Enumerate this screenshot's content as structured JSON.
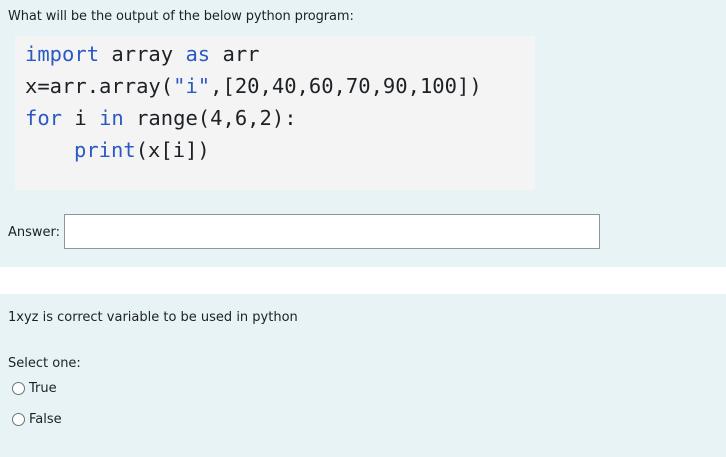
{
  "question1": {
    "prompt": "What will be the output of the below python program:",
    "code": {
      "line1": {
        "kw_import": "import",
        "mid": " array ",
        "kw_as": "as",
        "end": " arr"
      },
      "line2": {
        "start": "x=arr.array(",
        "str": "\"i\"",
        "end": ",[20,40,60,70,90,100])"
      },
      "line3": {
        "kw_for": "for",
        "mid": " i ",
        "kw_in": "in",
        "end": " range(4,6,2):"
      },
      "line4": {
        "fn": "print",
        "end": "(x[i])"
      }
    },
    "answer_label": "Answer:",
    "answer_value": ""
  },
  "question2": {
    "prompt": "1xyz is correct variable to be used in python",
    "select_label": "Select one:",
    "options": [
      {
        "label": "True"
      },
      {
        "label": "False"
      }
    ]
  },
  "colors": {
    "question_bg": "#e7f3f5",
    "code_bg": "#f4f4f4",
    "keyword": "#2b59c3"
  }
}
